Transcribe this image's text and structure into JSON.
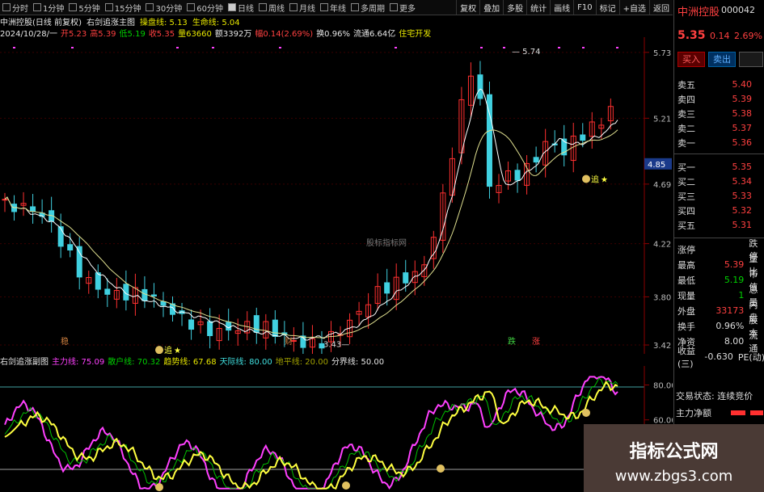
{
  "toolbar": {
    "periods": [
      "分时",
      "1分钟",
      "5分钟",
      "15分钟",
      "30分钟",
      "60分钟",
      "日线",
      "周线",
      "月线",
      "年线",
      "多周期",
      "更多"
    ],
    "active_period": "日线",
    "buttons": [
      "复权",
      "叠加",
      "多股",
      "统计",
      "画线",
      "F10",
      "标记",
      "+自选",
      "返回"
    ]
  },
  "info": {
    "title": "中洲控股(日线 前复权)",
    "indicator": "右剑追涨主图",
    "pan_label": "操盘线: 5.13",
    "life_label": "生命线: 5.04",
    "date": "2024/10/28/一",
    "open": "开5.23",
    "high": "高5.39",
    "low": "低5.19",
    "close": "收5.35",
    "volume": "量63660",
    "amount": "额3392万",
    "change": "幅0.14(2.69%)",
    "turnover": "换0.96%",
    "float": "流通6.64亿",
    "sector": "住宅开发"
  },
  "sub_info": {
    "name": "右剑追涨副图",
    "main": "主力线: 75.09",
    "retail": "散户线: 70.32",
    "trend": "趋势线: 67.68",
    "sky": "天际线: 80.00",
    "ground": "地平线: 20.00",
    "divider": "分界线: 50.00"
  },
  "price_axis": [
    "5.73",
    "5.21",
    "4.69",
    "4.22",
    "3.80",
    "3.42"
  ],
  "price_marker": "4.85",
  "sub_axis": [
    "80.00",
    "60.00"
  ],
  "annotations": {
    "peak": "5.74",
    "low": "3.43",
    "chase": "追",
    "star": "★",
    "markers": [
      "稳",
      "财",
      "跌",
      "涨"
    ],
    "watermark": "股标指标网"
  },
  "chart_data": {
    "type": "candlestick",
    "title": "中洲控股(日线 前复权)",
    "ylim": [
      3.35,
      5.85
    ],
    "x": [
      "…",
      "2024/10/28"
    ],
    "last_candle": {
      "date": "2024/10/28",
      "open": 5.23,
      "high": 5.39,
      "low": 5.19,
      "close": 5.35
    },
    "peak_label": 5.74,
    "low_label": 3.43,
    "series": [
      {
        "name": "操盘线",
        "last": 5.13,
        "color": "#ffffff"
      },
      {
        "name": "生命线",
        "last": 5.04,
        "color": "#e8e8a0"
      }
    ],
    "sub_chart": {
      "type": "line",
      "ylim": [
        0,
        100
      ],
      "series": [
        {
          "name": "主力线",
          "last": 75.09,
          "color": "#ff40ff"
        },
        {
          "name": "散户线",
          "last": 70.32,
          "color": "#00c000"
        },
        {
          "name": "趋势线",
          "last": 67.68,
          "color": "#ffff40"
        },
        {
          "name": "天际线",
          "last": 80.0,
          "color": "#40e0e0"
        },
        {
          "name": "地平线",
          "last": 20.0,
          "color": "#a0a000"
        },
        {
          "name": "分界线",
          "last": 50.0,
          "color": "#ffffff"
        }
      ]
    }
  },
  "quote": {
    "name": "中洲控股",
    "code": "000042",
    "price": "5.35",
    "change": "0.14",
    "pct": "2.69%",
    "buy_btn": "买入",
    "sell_btn": "卖出",
    "asks": [
      {
        "label": "卖五",
        "price": "5.40"
      },
      {
        "label": "卖四",
        "price": "5.39"
      },
      {
        "label": "卖三",
        "price": "5.38"
      },
      {
        "label": "卖二",
        "price": "5.37"
      },
      {
        "label": "卖一",
        "price": "5.36"
      }
    ],
    "bids": [
      {
        "label": "买一",
        "price": "5.35"
      },
      {
        "label": "买二",
        "price": "5.34"
      },
      {
        "label": "买三",
        "price": "5.33"
      },
      {
        "label": "买四",
        "price": "5.32"
      },
      {
        "label": "买五",
        "price": "5.31"
      }
    ],
    "stats": [
      {
        "label": "涨停",
        "value": "",
        "extra": "跌停"
      },
      {
        "label": "最高",
        "value": "5.39",
        "extra": "量比"
      },
      {
        "label": "最低",
        "value": "5.19",
        "extra": "市值"
      },
      {
        "label": "现量",
        "value": "1",
        "extra": "总量"
      },
      {
        "label": "外盘",
        "value": "33173",
        "extra": "内盘"
      },
      {
        "label": "换手",
        "value": "0.96%",
        "extra": "股本"
      },
      {
        "label": "净资",
        "value": "8.00",
        "extra": "流通"
      },
      {
        "label": "收益(三)",
        "value": "-0.630",
        "extra": "PE(动)"
      }
    ],
    "trade_status_label": "交易状态: 连续竞价",
    "main_net_label": "主力净额"
  },
  "banner": {
    "title": "指标公式网",
    "url": "www.zbgs3.com"
  }
}
